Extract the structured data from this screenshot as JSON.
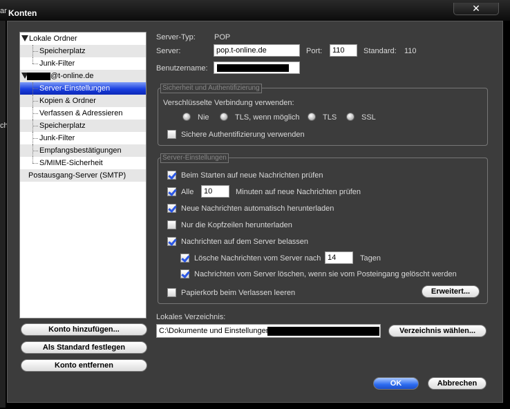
{
  "window": {
    "title": "Konten",
    "close_glyph": "✕"
  },
  "left_edge_texts": [
    "ar",
    "ch"
  ],
  "tree": {
    "items": [
      {
        "label": "Lokale Ordner",
        "level": 0,
        "expanded": true
      },
      {
        "label": "Speicherplatz",
        "level": 1
      },
      {
        "label": "Junk-Filter",
        "level": 1
      },
      {
        "label": "@t-online.de",
        "level": 0,
        "expanded": true
      },
      {
        "label": "Server-Einstellungen",
        "level": 1,
        "selected": true
      },
      {
        "label": "Kopien & Ordner",
        "level": 1
      },
      {
        "label": "Verfassen & Adressieren",
        "level": 1
      },
      {
        "label": "Speicherplatz",
        "level": 1
      },
      {
        "label": "Junk-Filter",
        "level": 1
      },
      {
        "label": "Empfangsbestätigungen",
        "level": 1
      },
      {
        "label": "S/MIME-Sicherheit",
        "level": 1
      },
      {
        "label": "Postausgang-Server (SMTP)",
        "level": 0
      }
    ]
  },
  "account_buttons": {
    "add": "Konto hinzufügen...",
    "set_default": "Als Standard festlegen",
    "remove": "Konto entfernen"
  },
  "server": {
    "type_label": "Server-Typ:",
    "type_value": "POP",
    "server_label": "Server:",
    "server_value": "pop.t-online.de",
    "port_label": "Port:",
    "port_value": "110",
    "standard_label": "Standard:",
    "standard_value": "110",
    "username_label": "Benutzername:"
  },
  "security": {
    "group_title": "Sicherheit und Authentifizierung",
    "encryption_label": "Verschlüsselte Verbindung verwenden:",
    "radios": [
      "Nie",
      "TLS, wenn möglich",
      "TLS",
      "SSL"
    ],
    "secure_auth_label": "Sichere Authentifizierung verwenden",
    "secure_auth_checked": false
  },
  "settings": {
    "group_title": "Server-Einstellungen",
    "check_on_start": {
      "label": "Beim Starten auf neue Nachrichten prüfen",
      "checked": true
    },
    "check_every": {
      "label": "Alle",
      "checked": true,
      "value": "10",
      "suffix": "Minuten auf neue Nachrichten prüfen"
    },
    "auto_download": {
      "label": "Neue Nachrichten automatisch herunterladen",
      "checked": true
    },
    "headers_only": {
      "label": "Nur die Kopfzeilen herunterladen",
      "checked": false
    },
    "leave_on_server": {
      "label": "Nachrichten auf dem Server belassen",
      "checked": true
    },
    "delete_after": {
      "label": "Lösche Nachrichten vom Server nach",
      "checked": true,
      "value": "14",
      "suffix": "Tagen"
    },
    "delete_when_removed": {
      "label": "Nachrichten vom Server löschen, wenn sie vom Posteingang gelöscht werden",
      "checked": true
    },
    "empty_trash": {
      "label": "Papierkorb beim Verlassen leeren",
      "checked": false
    },
    "advanced_button": "Erweitert..."
  },
  "local_dir": {
    "label": "Lokales Verzeichnis:",
    "value": "C:\\Dokumente und Einstellungen\\",
    "choose_button": "Verzeichnis wählen..."
  },
  "dialog_buttons": {
    "ok": "OK",
    "cancel": "Abbrechen"
  }
}
